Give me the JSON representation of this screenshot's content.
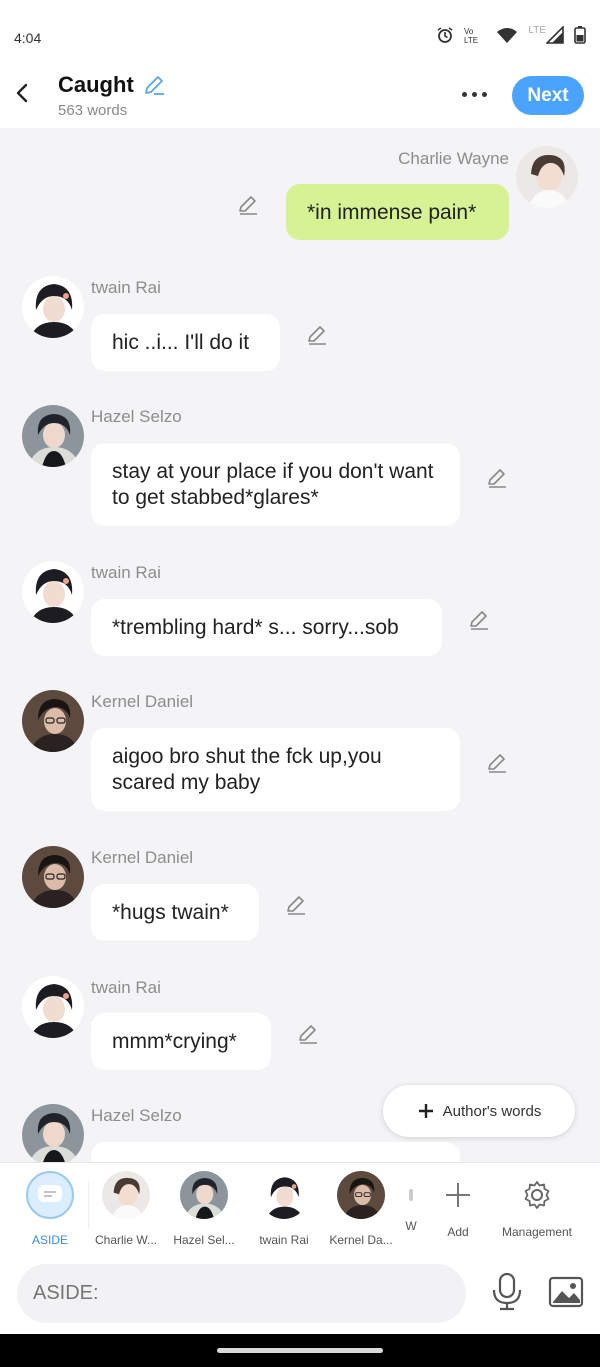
{
  "status": {
    "time": "4:04",
    "lte": "LTE"
  },
  "header": {
    "title": "Caught",
    "words": "563 words",
    "next_label": "Next"
  },
  "messages": [
    {
      "name": "Charlie Wayne",
      "text": "*in immense pain*"
    },
    {
      "name": "twain Rai",
      "text": "hic ..i... I'll do it"
    },
    {
      "name": "Hazel Selzo",
      "text": "stay at your place if you don't want to get stabbed*glares*"
    },
    {
      "name": "twain Rai",
      "text": "*trembling hard* s... sorry...sob"
    },
    {
      "name": "Kernel Daniel",
      "text": "aigoo bro shut the fck up,you scared my baby"
    },
    {
      "name": "Kernel Daniel",
      "text": "*hugs twain*"
    },
    {
      "name": "twain Rai",
      "text": "mmm*crying*"
    },
    {
      "name": "Hazel Selzo",
      "text": ""
    }
  ],
  "author_words_label": "Author's words",
  "cast_bar": {
    "items": [
      "ASIDE",
      "Charlie W...",
      "Hazel Sel...",
      "twain Rai",
      "Kernel Da...",
      "W"
    ],
    "add_label": "Add",
    "management_label": "Management"
  },
  "input": {
    "placeholder": "ASIDE:"
  },
  "colors": {
    "accent": "#4aa3ff",
    "my_bubble": "#d7f295",
    "background": "#f4f4f6"
  }
}
